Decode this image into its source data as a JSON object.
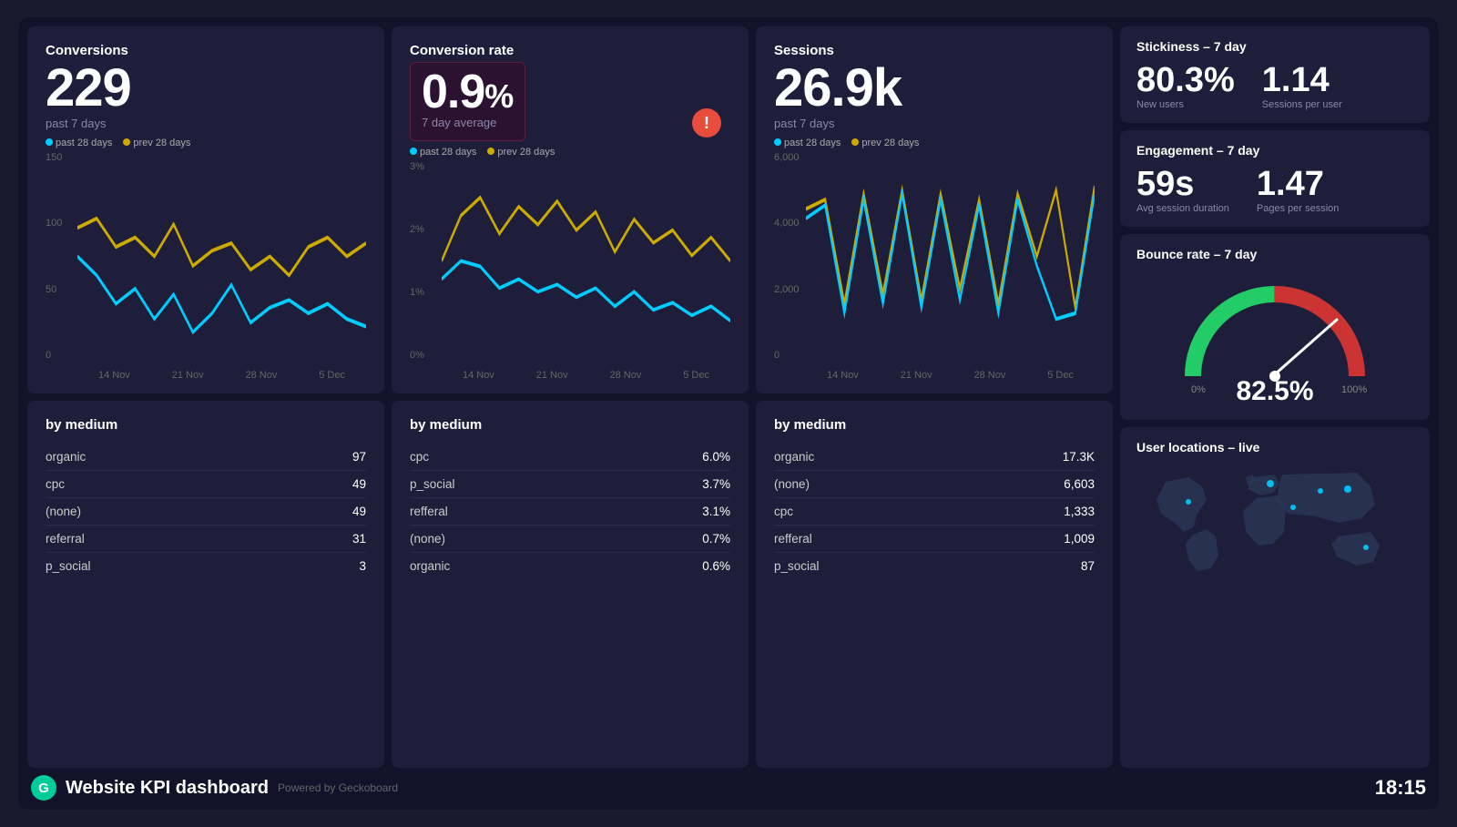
{
  "conversions": {
    "title": "Conversions",
    "value": "229",
    "subtitle": "past 7 days",
    "legend": {
      "past": "past 28 days",
      "prev": "prev 28 days"
    },
    "y_labels": [
      "150",
      "100",
      "50",
      "0"
    ],
    "x_labels": [
      "14 Nov",
      "21 Nov",
      "28 Nov",
      "5 Dec"
    ]
  },
  "conversion_rate": {
    "title": "Conversion rate",
    "value": "0.9",
    "unit": "%",
    "subtitle": "7 day average",
    "alert": "!",
    "legend": {
      "past": "past 28 days",
      "prev": "prev 28 days"
    },
    "y_labels": [
      "3%",
      "2%",
      "1%",
      "0%"
    ],
    "x_labels": [
      "14 Nov",
      "21 Nov",
      "28 Nov",
      "5 Dec"
    ]
  },
  "sessions": {
    "title": "Sessions",
    "value": "26.9k",
    "subtitle": "past 7 days",
    "legend": {
      "past": "past 28 days",
      "prev": "prev 28 days"
    },
    "y_labels": [
      "6,000",
      "4,000",
      "2,000",
      "0"
    ],
    "x_labels": [
      "14 Nov",
      "21 Nov",
      "28 Nov",
      "5 Dec"
    ]
  },
  "stickiness": {
    "title": "Stickiness – 7 day",
    "new_users_value": "80.3%",
    "new_users_label": "New users",
    "sessions_per_user_value": "1.14",
    "sessions_per_user_label": "Sessions per user"
  },
  "engagement": {
    "title": "Engagement – 7 day",
    "avg_session_value": "59s",
    "avg_session_label": "Avg session duration",
    "pages_per_session_value": "1.47",
    "pages_per_session_label": "Pages per session"
  },
  "bounce_rate": {
    "title": "Bounce rate – 7 day",
    "value": "82.5%"
  },
  "user_locations": {
    "title": "User locations – live"
  },
  "by_medium_conversions": {
    "title": "by medium",
    "rows": [
      {
        "label": "organic",
        "value": "97"
      },
      {
        "label": "cpc",
        "value": "49"
      },
      {
        "label": "(none)",
        "value": "49"
      },
      {
        "label": "referral",
        "value": "31"
      },
      {
        "label": "p_social",
        "value": "3"
      }
    ]
  },
  "by_medium_conv_rate": {
    "title": "by medium",
    "rows": [
      {
        "label": "cpc",
        "value": "6.0%"
      },
      {
        "label": "p_social",
        "value": "3.7%"
      },
      {
        "label": "refferal",
        "value": "3.1%"
      },
      {
        "label": "(none)",
        "value": "0.7%"
      },
      {
        "label": "organic",
        "value": "0.6%"
      }
    ]
  },
  "by_medium_sessions": {
    "title": "by medium",
    "rows": [
      {
        "label": "organic",
        "value": "17.3K"
      },
      {
        "label": "(none)",
        "value": "6,603"
      },
      {
        "label": "cpc",
        "value": "1,333"
      },
      {
        "label": "refferal",
        "value": "1,009"
      },
      {
        "label": "p_social",
        "value": "87"
      }
    ]
  },
  "footer": {
    "title": "Website KPI dashboard",
    "powered": "Powered by Geckoboard",
    "time": "18:15"
  }
}
